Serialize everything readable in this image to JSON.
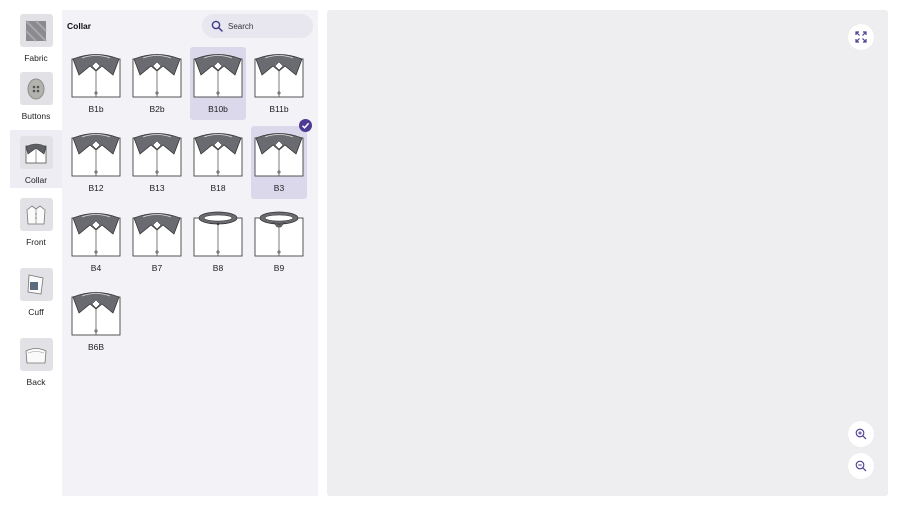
{
  "categories": [
    {
      "id": "fabric",
      "label": "Fabric",
      "icon": "fabric-swatch-icon",
      "active": false
    },
    {
      "id": "buttons",
      "label": "Buttons",
      "icon": "button-icon",
      "active": false
    },
    {
      "id": "collar",
      "label": "Collar",
      "icon": "collar-icon",
      "active": true
    },
    {
      "id": "front",
      "label": "Front",
      "icon": "shirt-front-icon",
      "active": false
    },
    {
      "id": "cuff",
      "label": "Cuff",
      "icon": "cuff-icon",
      "active": false
    },
    {
      "id": "back",
      "label": "Back",
      "icon": "shirt-back-icon",
      "active": false
    }
  ],
  "panel": {
    "title": "Collar",
    "search_placeholder": "Search"
  },
  "collars": [
    {
      "code": "B1b",
      "style": "spread",
      "highlighted": false,
      "selected": false
    },
    {
      "code": "B2b",
      "style": "spread",
      "highlighted": false,
      "selected": false
    },
    {
      "code": "B10b",
      "style": "spread",
      "highlighted": true,
      "selected": false
    },
    {
      "code": "B11b",
      "style": "spread",
      "highlighted": false,
      "selected": false
    },
    {
      "code": "B12",
      "style": "spread",
      "highlighted": false,
      "selected": false
    },
    {
      "code": "B13",
      "style": "spread",
      "highlighted": false,
      "selected": false
    },
    {
      "code": "B18",
      "style": "spread",
      "highlighted": false,
      "selected": false
    },
    {
      "code": "B3",
      "style": "spread",
      "highlighted": true,
      "selected": true
    },
    {
      "code": "B4",
      "style": "spread",
      "highlighted": false,
      "selected": false
    },
    {
      "code": "B7",
      "style": "spread",
      "highlighted": false,
      "selected": false
    },
    {
      "code": "B8",
      "style": "band",
      "highlighted": false,
      "selected": false
    },
    {
      "code": "B9",
      "style": "band-wing",
      "highlighted": false,
      "selected": false
    },
    {
      "code": "B6B",
      "style": "spread",
      "highlighted": false,
      "selected": false
    }
  ],
  "preview": {
    "fullscreen_icon": "expand-icon",
    "zoom_in_icon": "zoom-in-icon",
    "zoom_out_icon": "zoom-out-icon"
  },
  "colors": {
    "accent": "#4d3a93",
    "highlight": "#dcd8ec",
    "panel_bg": "#f2f2f7",
    "preview_bg": "#eeeef1",
    "collar_fill": "#6a6b70"
  }
}
